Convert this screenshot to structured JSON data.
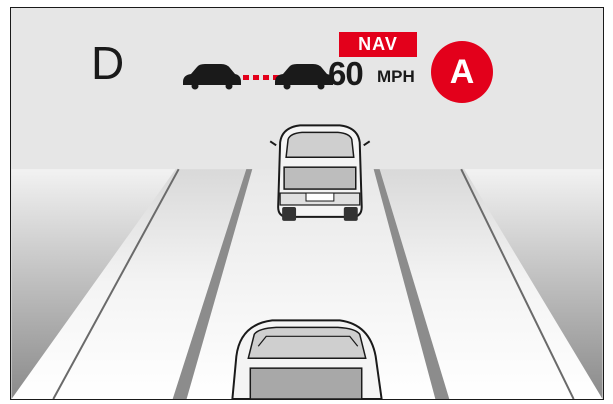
{
  "cluster": {
    "gear": "D",
    "nav_label": "NAV",
    "set_speed": "60",
    "speed_unit": "MPH",
    "status_badge": "A",
    "accent_color": "#e3001b"
  },
  "icons": {
    "distance": "following-distance-icon",
    "lead_vehicle": "lead-vehicle-icon",
    "ego_vehicle": "ego-vehicle-icon"
  }
}
